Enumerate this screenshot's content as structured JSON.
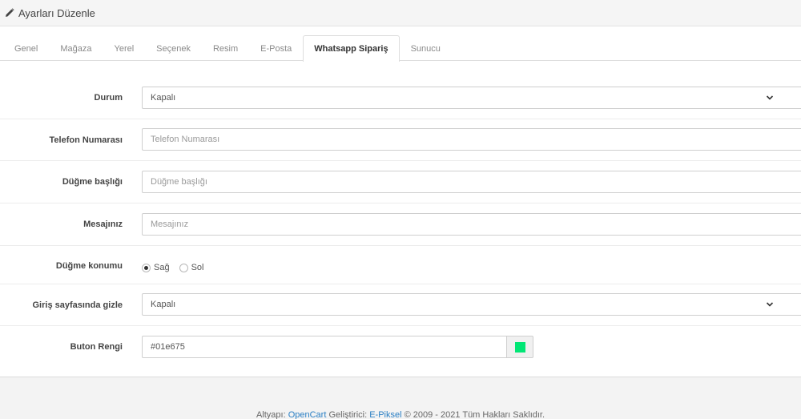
{
  "header": {
    "title": "Ayarları Düzenle",
    "icon": "pencil-icon"
  },
  "tabs": [
    {
      "label": "Genel",
      "active": false
    },
    {
      "label": "Mağaza",
      "active": false
    },
    {
      "label": "Yerel",
      "active": false
    },
    {
      "label": "Seçenek",
      "active": false
    },
    {
      "label": "Resim",
      "active": false
    },
    {
      "label": "E-Posta",
      "active": false
    },
    {
      "label": "Whatsapp Sipariş",
      "active": true
    },
    {
      "label": "Sunucu",
      "active": false
    }
  ],
  "form": {
    "status": {
      "label": "Durum",
      "value": "Kapalı"
    },
    "phone": {
      "label": "Telefon Numarası",
      "placeholder": "Telefon Numarası"
    },
    "button_title": {
      "label": "Düğme başlığı",
      "placeholder": "Düğme başlığı"
    },
    "message": {
      "label": "Mesajınız",
      "placeholder": "Mesajınız"
    },
    "button_position": {
      "label": "Düğme konumu",
      "options": [
        "Sağ",
        "Sol"
      ],
      "selected": "Sağ"
    },
    "hide_on_home": {
      "label": "Giriş sayfasında gizle",
      "value": "Kapalı"
    },
    "button_color": {
      "label": "Buton Rengi",
      "value": "#01e675",
      "swatch": "#01e675"
    }
  },
  "footer": {
    "prefix": "Altyapı:",
    "platform": "OpenCart",
    "developer_prefix": "Geliştirici:",
    "developer": "E-Piksel",
    "suffix": "© 2009 - 2021 Tüm Hakları Saklıdır."
  },
  "colors": {
    "accent": "#2a7fc4",
    "swatch": "#01e675"
  }
}
